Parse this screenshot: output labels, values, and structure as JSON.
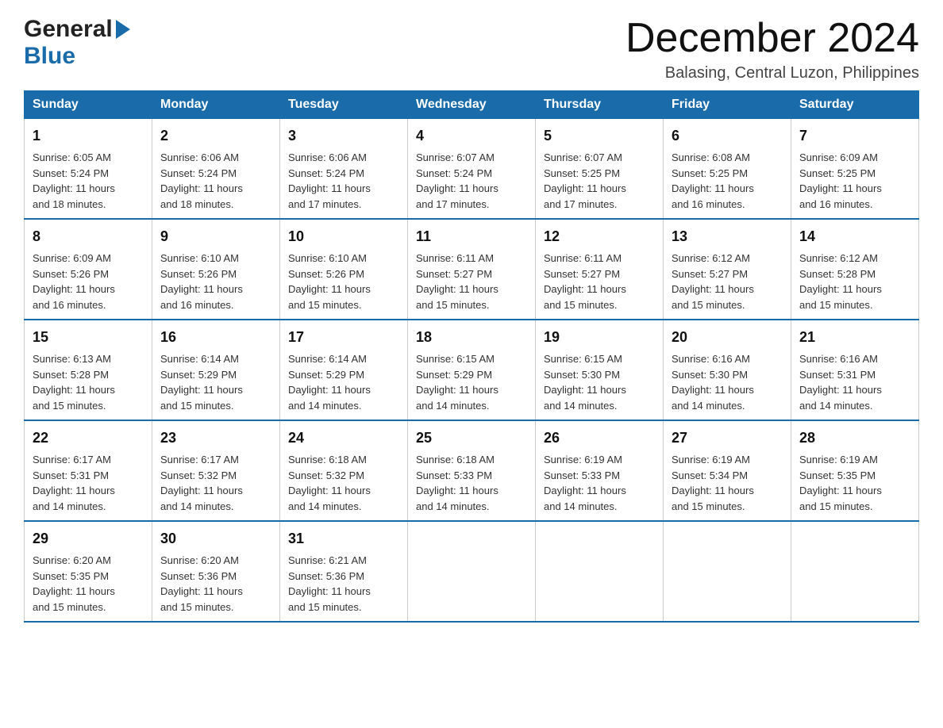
{
  "header": {
    "month_title": "December 2024",
    "subtitle": "Balasing, Central Luzon, Philippines",
    "logo_general": "General",
    "logo_blue": "Blue"
  },
  "calendar": {
    "days_of_week": [
      "Sunday",
      "Monday",
      "Tuesday",
      "Wednesday",
      "Thursday",
      "Friday",
      "Saturday"
    ],
    "weeks": [
      [
        {
          "day": "1",
          "sunrise": "6:05 AM",
          "sunset": "5:24 PM",
          "daylight": "11 hours and 18 minutes."
        },
        {
          "day": "2",
          "sunrise": "6:06 AM",
          "sunset": "5:24 PM",
          "daylight": "11 hours and 18 minutes."
        },
        {
          "day": "3",
          "sunrise": "6:06 AM",
          "sunset": "5:24 PM",
          "daylight": "11 hours and 17 minutes."
        },
        {
          "day": "4",
          "sunrise": "6:07 AM",
          "sunset": "5:24 PM",
          "daylight": "11 hours and 17 minutes."
        },
        {
          "day": "5",
          "sunrise": "6:07 AM",
          "sunset": "5:25 PM",
          "daylight": "11 hours and 17 minutes."
        },
        {
          "day": "6",
          "sunrise": "6:08 AM",
          "sunset": "5:25 PM",
          "daylight": "11 hours and 16 minutes."
        },
        {
          "day": "7",
          "sunrise": "6:09 AM",
          "sunset": "5:25 PM",
          "daylight": "11 hours and 16 minutes."
        }
      ],
      [
        {
          "day": "8",
          "sunrise": "6:09 AM",
          "sunset": "5:26 PM",
          "daylight": "11 hours and 16 minutes."
        },
        {
          "day": "9",
          "sunrise": "6:10 AM",
          "sunset": "5:26 PM",
          "daylight": "11 hours and 16 minutes."
        },
        {
          "day": "10",
          "sunrise": "6:10 AM",
          "sunset": "5:26 PM",
          "daylight": "11 hours and 15 minutes."
        },
        {
          "day": "11",
          "sunrise": "6:11 AM",
          "sunset": "5:27 PM",
          "daylight": "11 hours and 15 minutes."
        },
        {
          "day": "12",
          "sunrise": "6:11 AM",
          "sunset": "5:27 PM",
          "daylight": "11 hours and 15 minutes."
        },
        {
          "day": "13",
          "sunrise": "6:12 AM",
          "sunset": "5:27 PM",
          "daylight": "11 hours and 15 minutes."
        },
        {
          "day": "14",
          "sunrise": "6:12 AM",
          "sunset": "5:28 PM",
          "daylight": "11 hours and 15 minutes."
        }
      ],
      [
        {
          "day": "15",
          "sunrise": "6:13 AM",
          "sunset": "5:28 PM",
          "daylight": "11 hours and 15 minutes."
        },
        {
          "day": "16",
          "sunrise": "6:14 AM",
          "sunset": "5:29 PM",
          "daylight": "11 hours and 15 minutes."
        },
        {
          "day": "17",
          "sunrise": "6:14 AM",
          "sunset": "5:29 PM",
          "daylight": "11 hours and 14 minutes."
        },
        {
          "day": "18",
          "sunrise": "6:15 AM",
          "sunset": "5:29 PM",
          "daylight": "11 hours and 14 minutes."
        },
        {
          "day": "19",
          "sunrise": "6:15 AM",
          "sunset": "5:30 PM",
          "daylight": "11 hours and 14 minutes."
        },
        {
          "day": "20",
          "sunrise": "6:16 AM",
          "sunset": "5:30 PM",
          "daylight": "11 hours and 14 minutes."
        },
        {
          "day": "21",
          "sunrise": "6:16 AM",
          "sunset": "5:31 PM",
          "daylight": "11 hours and 14 minutes."
        }
      ],
      [
        {
          "day": "22",
          "sunrise": "6:17 AM",
          "sunset": "5:31 PM",
          "daylight": "11 hours and 14 minutes."
        },
        {
          "day": "23",
          "sunrise": "6:17 AM",
          "sunset": "5:32 PM",
          "daylight": "11 hours and 14 minutes."
        },
        {
          "day": "24",
          "sunrise": "6:18 AM",
          "sunset": "5:32 PM",
          "daylight": "11 hours and 14 minutes."
        },
        {
          "day": "25",
          "sunrise": "6:18 AM",
          "sunset": "5:33 PM",
          "daylight": "11 hours and 14 minutes."
        },
        {
          "day": "26",
          "sunrise": "6:19 AM",
          "sunset": "5:33 PM",
          "daylight": "11 hours and 14 minutes."
        },
        {
          "day": "27",
          "sunrise": "6:19 AM",
          "sunset": "5:34 PM",
          "daylight": "11 hours and 15 minutes."
        },
        {
          "day": "28",
          "sunrise": "6:19 AM",
          "sunset": "5:35 PM",
          "daylight": "11 hours and 15 minutes."
        }
      ],
      [
        {
          "day": "29",
          "sunrise": "6:20 AM",
          "sunset": "5:35 PM",
          "daylight": "11 hours and 15 minutes."
        },
        {
          "day": "30",
          "sunrise": "6:20 AM",
          "sunset": "5:36 PM",
          "daylight": "11 hours and 15 minutes."
        },
        {
          "day": "31",
          "sunrise": "6:21 AM",
          "sunset": "5:36 PM",
          "daylight": "11 hours and 15 minutes."
        },
        null,
        null,
        null,
        null
      ]
    ],
    "labels": {
      "sunrise": "Sunrise:",
      "sunset": "Sunset:",
      "daylight": "Daylight:"
    }
  }
}
